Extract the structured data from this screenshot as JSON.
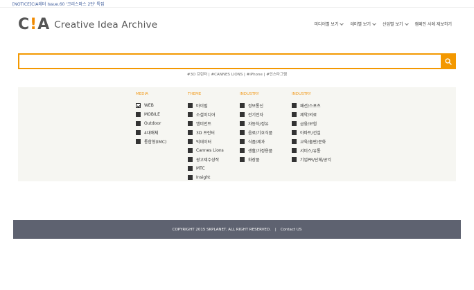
{
  "notice": "[NOTICE]CIA레터 Issue.60 '크리스마스 2탄' 특집",
  "logo": {
    "mark_left": "C",
    "mark_bang": "!",
    "mark_right": "A",
    "text": "Creative Idea Archive"
  },
  "nav": [
    {
      "label": "미디어별 보기",
      "dropdown": true
    },
    {
      "label": "테마별 보기",
      "dropdown": true
    },
    {
      "label": "산업별 보기",
      "dropdown": true
    },
    {
      "label": "캠페인 사례 제보하기",
      "dropdown": false
    }
  ],
  "search": {
    "value": "",
    "placeholder": "",
    "button_icon": "search-icon",
    "accent": "#f39800"
  },
  "hashtags": [
    "#3D 프린터",
    "#CANNES LIONS",
    "#iPhone",
    "#인스타그램"
  ],
  "filters": [
    {
      "title": "MEDIA",
      "options": [
        {
          "label": "WEB",
          "checked": true
        },
        {
          "label": "MOBILE",
          "checked": false
        },
        {
          "label": "Outdoor",
          "checked": false
        },
        {
          "label": "4대매체",
          "checked": false
        },
        {
          "label": "통합형(IMC)",
          "checked": false
        }
      ]
    },
    {
      "title": "THEME",
      "options": [
        {
          "label": "바이럴",
          "checked": false
        },
        {
          "label": "소셜미디어",
          "checked": false
        },
        {
          "label": "앰비언트",
          "checked": false
        },
        {
          "label": "3D 프린터",
          "checked": false
        },
        {
          "label": "빅데이터",
          "checked": false
        },
        {
          "label": "Cannes Lions",
          "checked": false
        },
        {
          "label": "광고제수상작",
          "checked": false
        },
        {
          "label": "MTC",
          "checked": false
        },
        {
          "label": "Insight",
          "checked": false
        }
      ]
    },
    {
      "title": "INDUSTRY",
      "options": [
        {
          "label": "정보통신",
          "checked": false
        },
        {
          "label": "전기전자",
          "checked": false
        },
        {
          "label": "자동차/정유",
          "checked": false
        },
        {
          "label": "음료/기호식품",
          "checked": false
        },
        {
          "label": "식품/제과",
          "checked": false
        },
        {
          "label": "생활/가정용품",
          "checked": false
        },
        {
          "label": "화장품",
          "checked": false
        }
      ]
    },
    {
      "title": "INDUSTRY",
      "options": [
        {
          "label": "패션/스포츠",
          "checked": false
        },
        {
          "label": "제약/의료",
          "checked": false
        },
        {
          "label": "금융/보험",
          "checked": false
        },
        {
          "label": "아파트/건설",
          "checked": false
        },
        {
          "label": "교육/출판/문화",
          "checked": false
        },
        {
          "label": "서비스/유통",
          "checked": false
        },
        {
          "label": "기업PR/단체/공익",
          "checked": false
        }
      ]
    }
  ],
  "footer": {
    "copyright": "COPYRIGHT 2015 SKPLANET. ALL RIGHT RESERVED.",
    "separator": "|",
    "contact": "Contact US"
  }
}
